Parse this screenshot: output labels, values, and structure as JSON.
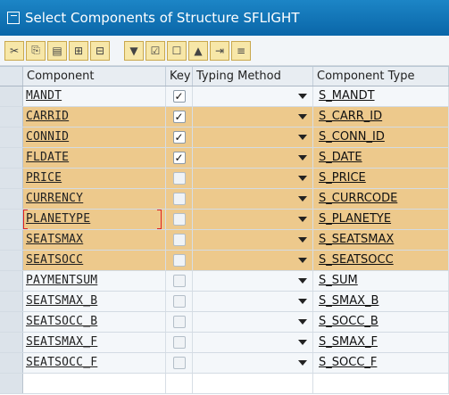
{
  "window": {
    "title": "Select Components of Structure SFLIGHT"
  },
  "toolbar": {
    "buttons": [
      {
        "icon": "cut-icon"
      },
      {
        "icon": "copy-icon"
      },
      {
        "icon": "paste-icon"
      },
      {
        "icon": "insert-row-icon"
      },
      {
        "icon": "delete-row-icon"
      },
      {
        "icon": "filter-icon"
      },
      {
        "icon": "select-all-icon"
      },
      {
        "icon": "deselect-all-icon"
      },
      {
        "icon": "sort-icon"
      },
      {
        "icon": "export-icon"
      },
      {
        "icon": "details-icon"
      }
    ]
  },
  "grid": {
    "headers": {
      "component": "Component",
      "key": "Key",
      "typing_method": "Typing Method",
      "component_type": "Component Type"
    },
    "rows": [
      {
        "component": "MANDT",
        "key": true,
        "type": "S_MANDT",
        "highlight": false
      },
      {
        "component": "CARRID",
        "key": true,
        "type": "S_CARR_ID",
        "highlight": true
      },
      {
        "component": "CONNID",
        "key": true,
        "type": "S_CONN_ID",
        "highlight": true
      },
      {
        "component": "FLDATE",
        "key": true,
        "type": "S_DATE",
        "highlight": true
      },
      {
        "component": "PRICE",
        "key": false,
        "type": "S_PRICE",
        "highlight": true
      },
      {
        "component": "CURRENCY",
        "key": false,
        "type": "S_CURRCODE",
        "highlight": true
      },
      {
        "component": "PLANETYPE",
        "key": false,
        "type": "S_PLANETYE",
        "highlight": true
      },
      {
        "component": "SEATSMAX",
        "key": false,
        "type": "S_SEATSMAX",
        "highlight": true
      },
      {
        "component": "SEATSOCC",
        "key": false,
        "type": "S_SEATSOCC",
        "highlight": true
      },
      {
        "component": "PAYMENTSUM",
        "key": false,
        "type": "S_SUM",
        "highlight": false
      },
      {
        "component": "SEATSMAX_B",
        "key": false,
        "type": "S_SMAX_B",
        "highlight": false
      },
      {
        "component": "SEATSOCC_B",
        "key": false,
        "type": "S_SOCC_B",
        "highlight": false
      },
      {
        "component": "SEATSMAX_F",
        "key": false,
        "type": "S_SMAX_F",
        "highlight": false
      },
      {
        "component": "SEATSOCC_F",
        "key": false,
        "type": "S_SOCC_F",
        "highlight": false
      }
    ]
  },
  "colors": {
    "title_bar": "#0a66a8",
    "highlight_row": "#edc98c"
  }
}
